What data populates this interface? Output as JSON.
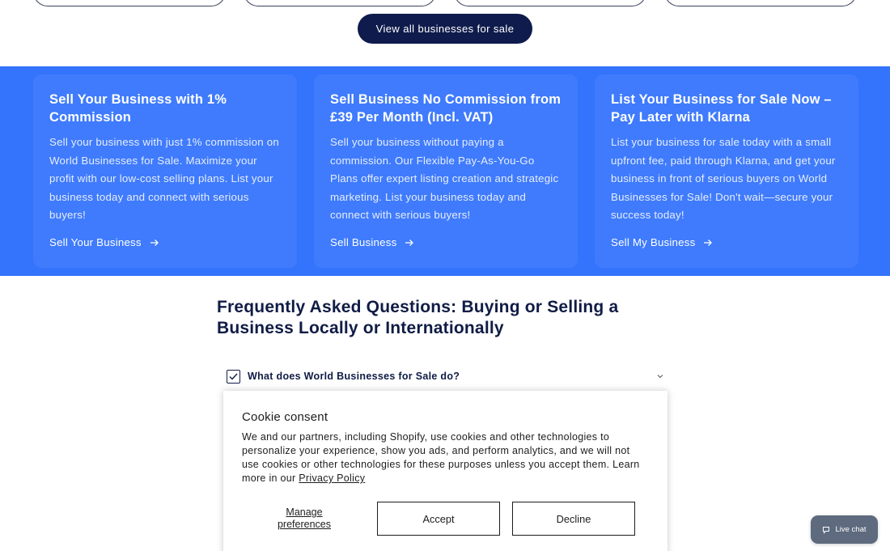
{
  "view_all_button": "View all businesses for sale",
  "promo_cards": [
    {
      "title": "Sell Your Business with 1% Commission",
      "text": "Sell your business with just 1% commission on World Businesses for Sale. Maximize your profit with our low-cost selling plans. List your business today and connect with serious buyers!",
      "link": "Sell Your Business"
    },
    {
      "title": "Sell Business No Commission from £39 Per Month (Incl. VAT)",
      "text": "Sell your business without paying a commission. Our Flexible Pay-As-You-Go Plans offer expert listing creation and strategic marketing. List your business today and connect with serious buyers!",
      "link": "Sell Business"
    },
    {
      "title": "List Your Business for Sale Now – Pay Later with Klarna",
      "text": "List your business for sale today with a small upfront fee, paid through Klarna, and get your business in front of serious buyers on World Businesses for Sale! Don't wait—secure your success today!",
      "link": "Sell My Business"
    }
  ],
  "faq": {
    "title": "Frequently Asked Questions: Buying or Selling a Business Locally or Internationally",
    "items": [
      {
        "question": "What does World Businesses for Sale do?"
      }
    ]
  },
  "cookie": {
    "title": "Cookie consent",
    "body": "We and our partners, including Shopify, use cookies and other technologies to personalize your experience, show you ads, and perform analytics, and we will not use cookies or other technologies for these purposes unless you accept them. Learn more in our ",
    "policy_link": "Privacy Policy",
    "manage": "Manage preferences",
    "accept": "Accept",
    "decline": "Decline"
  },
  "live_chat": "Live chat",
  "colors": {
    "band": "#3473fc",
    "navy": "#0f1b4c",
    "chat": "#5e6a7e"
  },
  "icons": [
    "arrow-right-icon",
    "checkbox-checked-icon",
    "chevron-down-icon",
    "chat-bubble-icon"
  ]
}
